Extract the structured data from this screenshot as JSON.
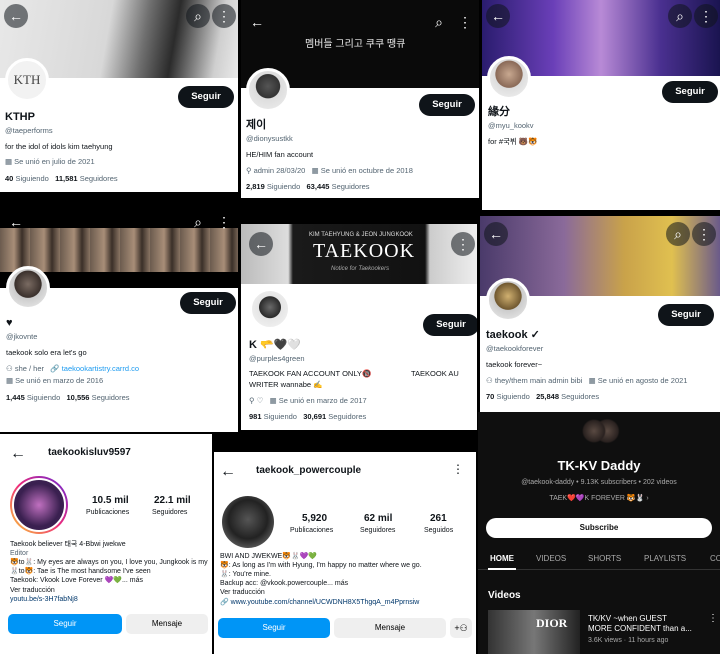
{
  "follow": "Seguir",
  "p1": {
    "name": "KTHP",
    "handle": "@taeperforms",
    "bio": "for the idol of idols kim taehyung",
    "joined": "Se unió en julio de 2021",
    "following": "40",
    "following_l": "Siguiendo",
    "followers": "11,581",
    "followers_l": "Seguidores",
    "initials": "KTH"
  },
  "p2": {
    "banner": "멤버들 그리고 쿠쿠 땡큐",
    "name": "제이",
    "handle": "@dionysustkk",
    "bio": "HE/HIM fan account",
    "meta1": "admin 28/03/20",
    "meta2": "Se unió en octubre de 2018",
    "following": "2,819",
    "following_l": "Siguiendo",
    "followers": "63,445",
    "followers_l": "Seguidores"
  },
  "p3": {
    "name": "緣分",
    "handle": "@myu_kookv",
    "bio": "for #국뷔 🐻🐯"
  },
  "p4": {
    "name": "♥",
    "handle": "@jkovnte",
    "bio": "taekook solo era let's go",
    "pronoun": "she / her",
    "link": "taekookartistry.carrd.co",
    "joined": "Se unió en marzo de 2016",
    "following": "1,445",
    "following_l": "Siguiendo",
    "followers": "10,556",
    "followers_l": "Seguidores"
  },
  "p5": {
    "banner_small": "KIM TAEHYUNG & JEON JUNGKOOK",
    "banner_big": "TAEKOOK",
    "banner_script": "Notice for Taekookers",
    "name": "K 🫳🖤🤍",
    "handle": "@purples4green",
    "bio1": "TAEKOOK FAN ACCOUNT ONLY🔞",
    "bio2": "TAEKOOK AU",
    "bio3": "WRITER wannabe ✍️",
    "meta1": "♡",
    "meta2": "Se unió en marzo de 2017",
    "following": "981",
    "following_l": "Siguiendo",
    "followers": "30,691",
    "followers_l": "Seguidores"
  },
  "p6": {
    "name": "taekook ✓",
    "handle": "@taekookforever",
    "bio": "taekook forever~",
    "meta1": "they/them main admin bibi",
    "meta2": "Se unió en agosto de 2021",
    "following": "70",
    "following_l": "Siguiendo",
    "followers": "25,848",
    "followers_l": "Seguidores"
  },
  "p7": {
    "username": "taekookisluv9597",
    "posts": "10.5 mil",
    "posts_l": "Publicaciones",
    "followers": "22.1 mil",
    "followers_l": "Seguidores",
    "bio1": "Taekook believer 태국 4-Bbwi jwekwe",
    "cat": "Editor",
    "bio2": "🐯to🐰: My eyes are always on you, I love you, Jungkook is my",
    "bio3": "🐰to🐯: Tae is The most handsome I've seen",
    "bio4": "Taekook: Vkook Love Forever 💜💚... más",
    "translate": "Ver traducción",
    "link": "youtu.be/s-3H7fabNj8",
    "follow": "Seguir",
    "message": "Mensaje"
  },
  "p8": {
    "username": "taekook_powercouple",
    "posts": "5,920",
    "posts_l": "Publicaciones",
    "followers": "62 mil",
    "followers_l": "Seguidores",
    "following": "261",
    "following_l": "Seguidos",
    "bio1": "BWI AND JWEKWE🐯🐰💜💚",
    "bio2": "🐯: As long as I'm with Hyung, I'm happy no matter where we go.",
    "bio3": "🐰: You're mine.",
    "bio4": "Backup acc: @vkook.powercouple... más",
    "translate": "Ver traducción",
    "link": "www.youtube.com/channel/UCWDNH8X5ThgqA_m4Pprnsiw",
    "follow": "Seguir",
    "message": "Mensaje"
  },
  "p9": {
    "name": "TK-KV Daddy",
    "meta": "@taekook-daddy • 9.13K subscribers • 202 videos",
    "tagline": "TAEK❤️💜K FOREVER 🐯🐰",
    "subscribe": "Subscribe",
    "tabs": [
      "HOME",
      "VIDEOS",
      "SHORTS",
      "PLAYLISTS",
      "CO"
    ],
    "videos_title": "Videos",
    "vid_title1": "TK/KV ~when GUEST",
    "vid_title2": "MORE CONFIDENT than a...",
    "vid_meta": "3.6K views · 11 hours ago",
    "thumb_text": "DIOR"
  },
  "colors": {
    "x_blue": "#1d9bf0",
    "ig_blue": "#0095f6",
    "yt_bg": "#0f0f0f"
  }
}
